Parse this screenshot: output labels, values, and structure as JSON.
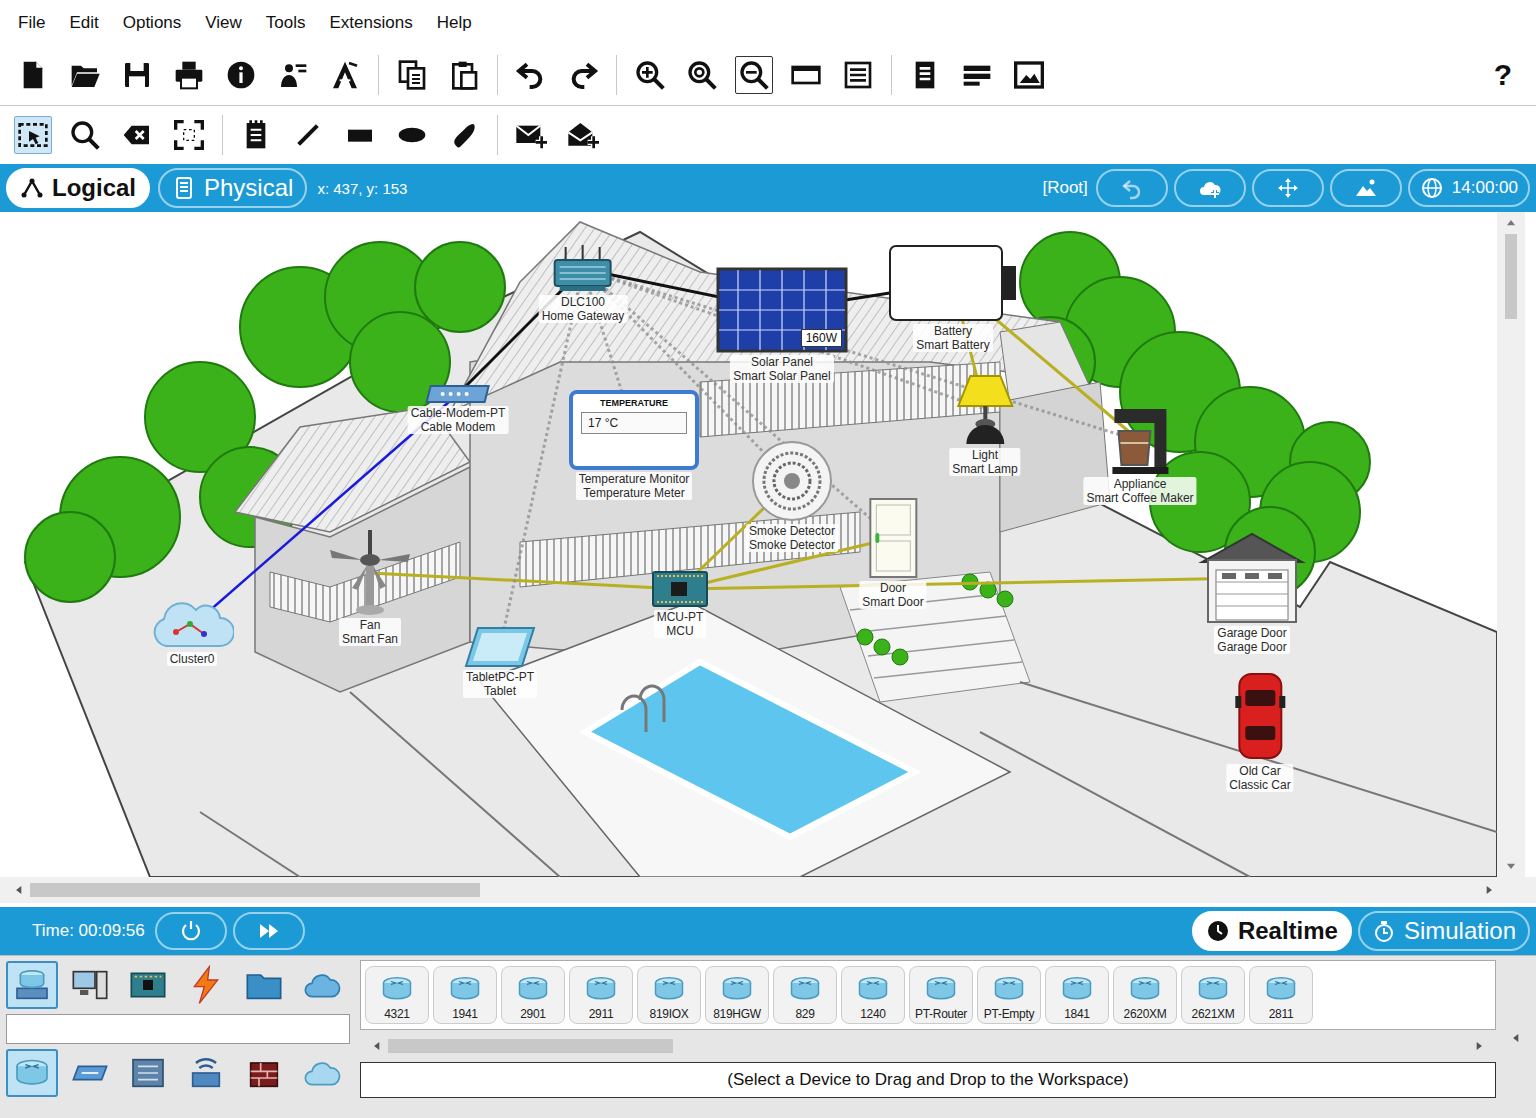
{
  "menu": [
    "File",
    "Edit",
    "Options",
    "View",
    "Tools",
    "Extensions",
    "Help"
  ],
  "main_toolbar": {
    "tools": [
      {
        "selected": false
      },
      {
        "selected": false
      },
      {
        "selected": false
      },
      {
        "selected": false
      },
      {
        "selected": false
      },
      {
        "selected": false
      },
      {
        "selected": false
      },
      {
        "selected": false
      },
      {
        "selected": false
      },
      {
        "selected": false
      },
      {
        "selected": false
      },
      {
        "selected": false
      },
      {
        "selected": false
      },
      {
        "selected": true
      },
      {
        "selected": false
      },
      {
        "selected": false
      },
      {
        "selected": false
      },
      {
        "selected": false
      },
      {
        "selected": false
      }
    ],
    "help": "?"
  },
  "secondary_toolbar": {
    "tools": [
      {
        "selected": true
      },
      {
        "selected": false
      },
      {
        "selected": false
      },
      {
        "selected": false
      },
      {
        "selected": false
      },
      {
        "selected": false
      },
      {
        "selected": false
      },
      {
        "selected": false
      },
      {
        "selected": false
      },
      {
        "selected": false
      },
      {
        "selected": false
      }
    ]
  },
  "workspace_bar": {
    "tabs": [
      {
        "label": "Logical",
        "selected": true
      },
      {
        "label": "Physical",
        "selected": false
      }
    ],
    "coordinates": "x: 437, y: 153",
    "location": "[Root]",
    "clock": "14:00:00"
  },
  "canvas": {
    "devices": [
      {
        "kind": "gateway",
        "name": "DLC100",
        "type": "Home Gateway"
      },
      {
        "kind": "modem",
        "name": "Cable-Modem-PT",
        "type": "Cable Modem"
      },
      {
        "kind": "solar",
        "name": "Solar Panel",
        "type": "Smart Solar Panel",
        "display": "160W"
      },
      {
        "kind": "battery",
        "name": "Battery",
        "type": "Smart Battery"
      },
      {
        "kind": "temperature",
        "name": "Temperature Monitor",
        "type": "Temperature Meter",
        "display_title": "TEMPERATURE",
        "display": "17 °C"
      },
      {
        "kind": "smoke",
        "name": "Smoke Detector",
        "type": "Smoke Detector"
      },
      {
        "kind": "lamp",
        "name": "Light",
        "type": "Smart Lamp"
      },
      {
        "kind": "coffee",
        "name": "Appliance",
        "type": "Smart Coffee Maker"
      },
      {
        "kind": "door",
        "name": "Door",
        "type": "Smart Door"
      },
      {
        "kind": "mcu",
        "name": "MCU-PT",
        "type": "MCU"
      },
      {
        "kind": "fan",
        "name": "Fan",
        "type": "Smart Fan"
      },
      {
        "kind": "tablet",
        "name": "TabletPC-PT",
        "type": "Tablet"
      },
      {
        "kind": "cluster",
        "name": "Cluster0"
      },
      {
        "kind": "garage",
        "name": "Garage Door",
        "type": "Garage Door"
      },
      {
        "kind": "car",
        "name": "Old Car",
        "type": "Classic Car"
      }
    ],
    "links": [
      {
        "from": "gateway",
        "to": "solar",
        "kind": "copper"
      },
      {
        "from": "gateway",
        "to": "modem",
        "kind": "copper"
      },
      {
        "from": "modem",
        "to": "cluster",
        "kind": "coax"
      },
      {
        "from": "solar",
        "to": "battery",
        "kind": "copper"
      },
      {
        "from": "battery",
        "to": "coffee",
        "kind": "iot"
      },
      {
        "from": "battery",
        "to": "lamp",
        "kind": "iot"
      },
      {
        "from": "mcu",
        "to": "fan",
        "kind": "iot"
      },
      {
        "from": "mcu",
        "to": "smoke",
        "kind": "iot"
      },
      {
        "from": "mcu",
        "to": "door",
        "kind": "iot"
      },
      {
        "from": "mcu",
        "to": "garage",
        "kind": "iot"
      },
      {
        "from": "gateway",
        "to": "temperature",
        "kind": "wireless"
      },
      {
        "from": "gateway",
        "to": "tablet",
        "kind": "wireless"
      },
      {
        "from": "gateway",
        "to": "smoke",
        "kind": "wireless"
      },
      {
        "from": "gateway",
        "to": "lamp",
        "kind": "wireless"
      },
      {
        "from": "gateway",
        "to": "coffee",
        "kind": "wireless"
      },
      {
        "from": "gateway",
        "to": "door",
        "kind": "wireless"
      }
    ]
  },
  "time_bar": {
    "time": "Time: 00:09:56",
    "modes": [
      {
        "label": "Realtime",
        "selected": true
      },
      {
        "label": "Simulation",
        "selected": false
      }
    ]
  },
  "palette": {
    "categories": [
      {
        "selected": true
      },
      {
        "selected": false
      },
      {
        "selected": false
      },
      {
        "selected": false
      },
      {
        "selected": false
      },
      {
        "selected": false
      }
    ],
    "category_field": "",
    "subcategories": [
      {
        "selected": true
      },
      {
        "selected": false
      },
      {
        "selected": false
      },
      {
        "selected": false
      },
      {
        "selected": false
      },
      {
        "selected": false
      }
    ],
    "models": [
      "4321",
      "1941",
      "2901",
      "2911",
      "819IOX",
      "819HGW",
      "829",
      "1240",
      "PT-Router",
      "PT-Empty",
      "1841",
      "2620XM",
      "2621XM",
      "2811"
    ],
    "hint": "(Select a Device to Drag and Drop to the Workspace)"
  }
}
